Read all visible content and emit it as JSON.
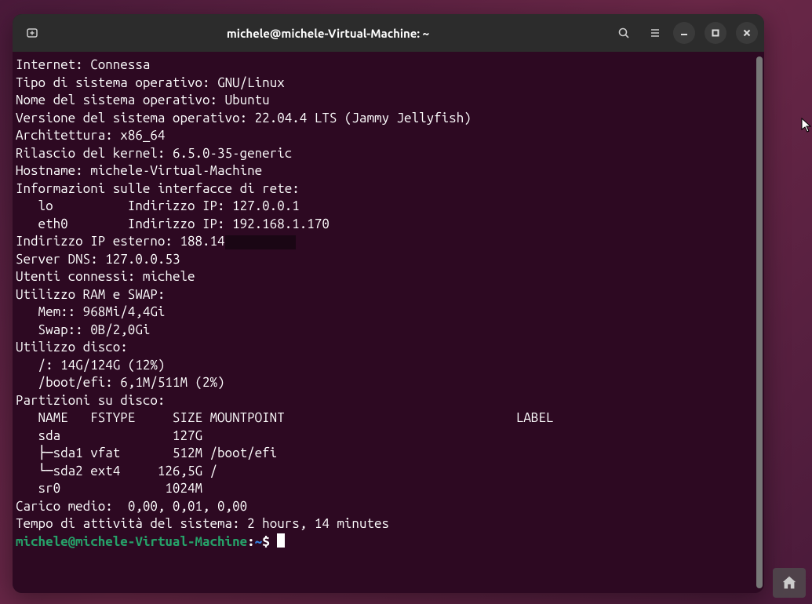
{
  "titlebar": {
    "title": "michele@michele-Virtual-Machine: ~"
  },
  "output": {
    "internet_label": "Internet:",
    "internet_value": "Connessa",
    "os_type_label": "Tipo di sistema operativo:",
    "os_type_value": "GNU/Linux",
    "os_name_label": "Nome del sistema operativo:",
    "os_name_value": "Ubuntu",
    "os_version_label": "Versione del sistema operativo:",
    "os_version_value": "22.04.4 LTS (Jammy Jellyfish)",
    "arch_label": "Architettura:",
    "arch_value": "x86_64",
    "kernel_label": "Rilascio del kernel:",
    "kernel_value": "6.5.0-35-generic",
    "hostname_label": "Hostname:",
    "hostname_value": "michele-Virtual-Machine",
    "net_if_header": "Informazioni sulle interfacce di rete:",
    "if_lo": "   lo          Indirizzo IP: 127.0.0.1",
    "if_eth0": "   eth0        Indirizzo IP: 192.168.1.170",
    "extip_label": "Indirizzo IP esterno:",
    "extip_value": "188.14",
    "dns_label": "Server DNS:",
    "dns_value": "127.0.0.53",
    "users_label": "Utenti connessi:",
    "users_value": "michele",
    "ram_header": "Utilizzo RAM e SWAP:",
    "mem_line": "   Mem:: 968Mi/4,4Gi",
    "swap_line": "   Swap:: 0B/2,0Gi",
    "disk_header": "Utilizzo disco:",
    "disk_root": "   /: 14G/124G (12%)",
    "disk_boot": "   /boot/efi: 6,1M/511M (2%)",
    "part_header": "Partizioni su disco:",
    "part_cols": "   NAME   FSTYPE     SIZE MOUNTPOINT                               LABEL",
    "part_sda": "   sda               127G",
    "part_sda1": "   ├─sda1 vfat       512M /boot/efi",
    "part_sda2": "   └─sda2 ext4     126,5G /",
    "part_sr0": "   sr0              1024M",
    "load_label": "Carico medio:",
    "load_value": " 0,00, 0,01, 0,00",
    "uptime_label": "Tempo di attività del sistema:",
    "uptime_value": "2 hours, 14 minutes"
  },
  "prompt": {
    "user_host": "michele@michele-Virtual-Machine",
    "colon": ":",
    "path": "~",
    "dollar": "$ "
  }
}
